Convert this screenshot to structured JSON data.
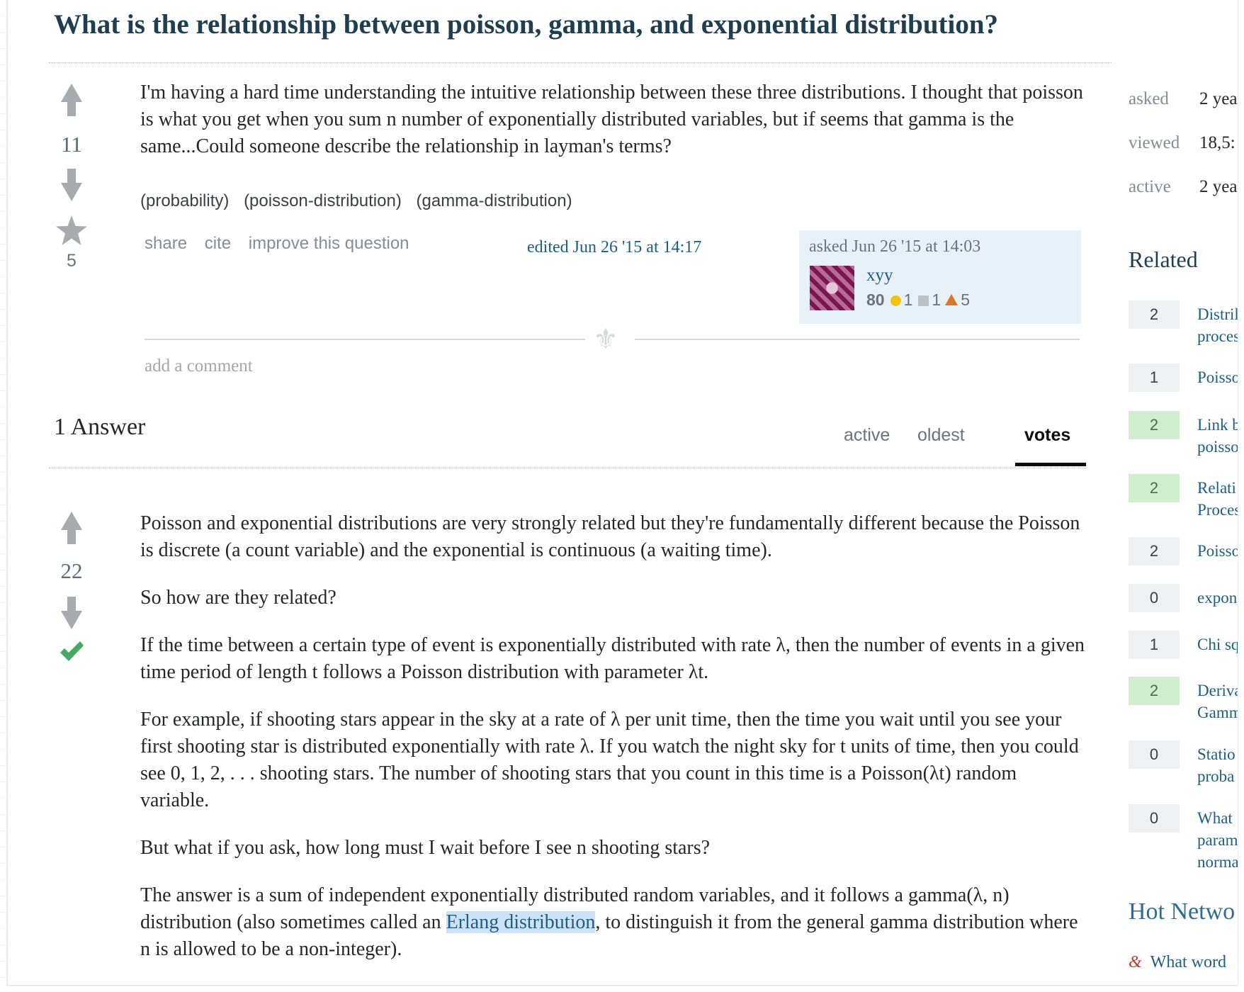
{
  "question": {
    "title": "What is the relationship between poisson, gamma, and exponential distribution?",
    "votes": "11",
    "favorites": "5",
    "body": "I'm having a hard time understanding the intuitive relationship between these three distributions. I thought that poisson is what you get when you sum n number of exponentially distributed variables, but if seems that gamma is the same...Could someone describe the relationship in layman's terms?",
    "tags": [
      "(probability)",
      "(poisson-distribution)",
      "(gamma-distribution)"
    ],
    "menu": {
      "share": "share",
      "cite": "cite",
      "improve": "improve this question"
    },
    "edited": "edited Jun 26 '15 at 14:17",
    "asked": "asked Jun 26 '15 at 14:03",
    "user": {
      "name": "xyy",
      "rep": "80",
      "gold": "",
      "silver": "1",
      "bronze": "1",
      "bronze_count": "5"
    },
    "add_comment": "add a comment"
  },
  "answers_header": "1 Answer",
  "sort_tabs": [
    "active",
    "oldest",
    "votes"
  ],
  "answer": {
    "votes": "22",
    "p1": "Poisson and exponential distributions are very strongly related but they're fundamentally different because the Poisson is discrete (a count variable) and the exponential is continuous (a waiting time).",
    "p2": "So how are they related?",
    "p3": "If the time between a certain type of event is exponentially distributed with rate λ, then the number of events in a given time period of length t follows a Poisson distribution with parameter λt.",
    "p4": "For example, if shooting stars appear in the sky at a rate of λ per unit time, then the time you wait until you see your first shooting star is distributed exponentially with rate λ. If you watch the night sky for t units of time, then you could see 0, 1, 2, . . . shooting stars. The number of shooting stars that you count in this time is a Poisson(λt) random variable.",
    "p5": "But what if you ask, how long must I wait before I see n shooting stars?",
    "p6_a": "The answer is a sum of independent exponentially distributed random variables, and it follows a gamma(λ, n) distribution (also sometimes called an ",
    "p6_link": "Erlang distribution",
    "p6_b": ", to distinguish it from the general gamma distribution where n is allowed to be a non-integer)."
  },
  "sidebar": {
    "meta": [
      {
        "label": "asked",
        "value": "2 yea"
      },
      {
        "label": "viewed",
        "value": "18,5:"
      },
      {
        "label": "active",
        "value": "2 yea"
      }
    ],
    "related_title": "Related",
    "related": [
      {
        "count": "2",
        "accepted": false,
        "text": "Distril\nproces"
      },
      {
        "count": "1",
        "accepted": false,
        "text": "Poisso"
      },
      {
        "count": "2",
        "accepted": true,
        "text": "Link b\npoisso"
      },
      {
        "count": "2",
        "accepted": true,
        "text": "Relati\nProces"
      },
      {
        "count": "2",
        "accepted": false,
        "text": "Poisso"
      },
      {
        "count": "0",
        "accepted": false,
        "text": "expon"
      },
      {
        "count": "1",
        "accepted": false,
        "text": "Chi sq"
      },
      {
        "count": "2",
        "accepted": true,
        "text": "Deriva\nGamm"
      },
      {
        "count": "0",
        "accepted": false,
        "text": "Statio\nproba"
      },
      {
        "count": "0",
        "accepted": false,
        "text": "What\nparam\nnorma"
      }
    ],
    "hot_title": "Hot Netwo",
    "hot_item": "What word"
  },
  "colors": {
    "title": "#1f3f4f",
    "link": "#1f5d86",
    "accepted": "#48a868",
    "accepted_badge": "#d2ecd1"
  }
}
